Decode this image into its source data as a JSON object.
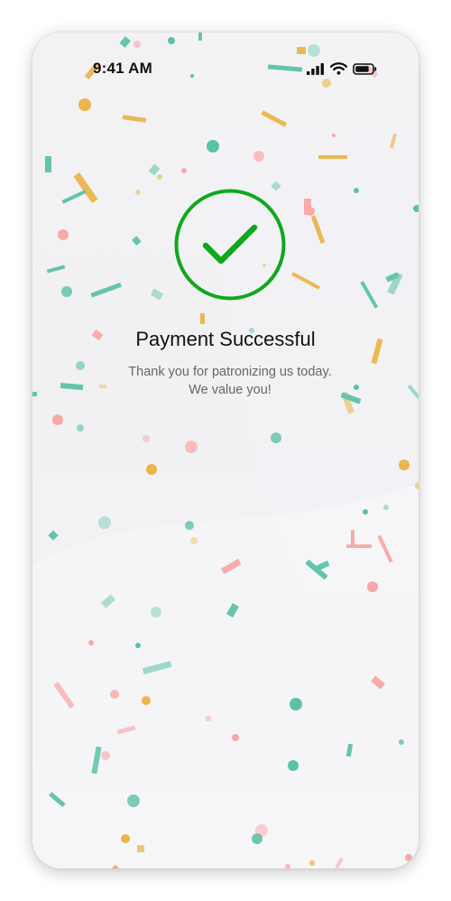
{
  "status_bar": {
    "time": "9:41 AM",
    "icons": [
      "signal-icon",
      "wifi-icon",
      "battery-icon"
    ]
  },
  "success": {
    "icon": "checkmark-circle-icon",
    "title": "Payment Successful",
    "message_line1": "Thank you for patronizing us today.",
    "message_line2": "We value you!"
  },
  "colors": {
    "check_green": "#0fa81c",
    "confetti_teal": "#5cc2a4",
    "confetti_yellow": "#eab54a",
    "confetti_pink": "#f7a8a8"
  }
}
